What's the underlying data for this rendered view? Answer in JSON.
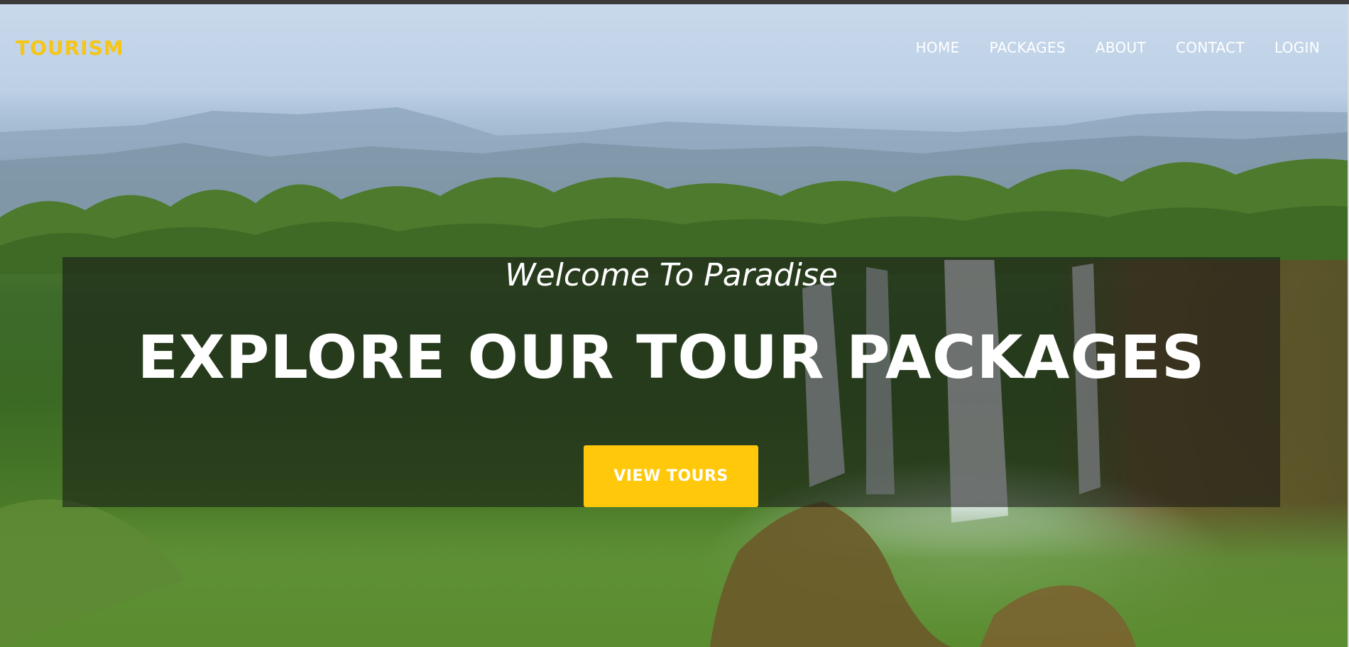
{
  "brand": {
    "name": "TOURISM"
  },
  "nav": {
    "items": [
      {
        "label": "HOME"
      },
      {
        "label": "PACKAGES"
      },
      {
        "label": "ABOUT"
      },
      {
        "label": "CONTACT"
      },
      {
        "label": "LOGIN"
      }
    ]
  },
  "hero": {
    "subtitle": "Welcome To Paradise",
    "title": "EXPLORE OUR TOUR PACKAGES",
    "cta_label": "VIEW TOURS"
  },
  "colors": {
    "brand_accent": "#f5c518",
    "cta_background": "#ffc80a",
    "overlay": "rgba(20,20,20,0.55)",
    "text": "#ffffff"
  }
}
